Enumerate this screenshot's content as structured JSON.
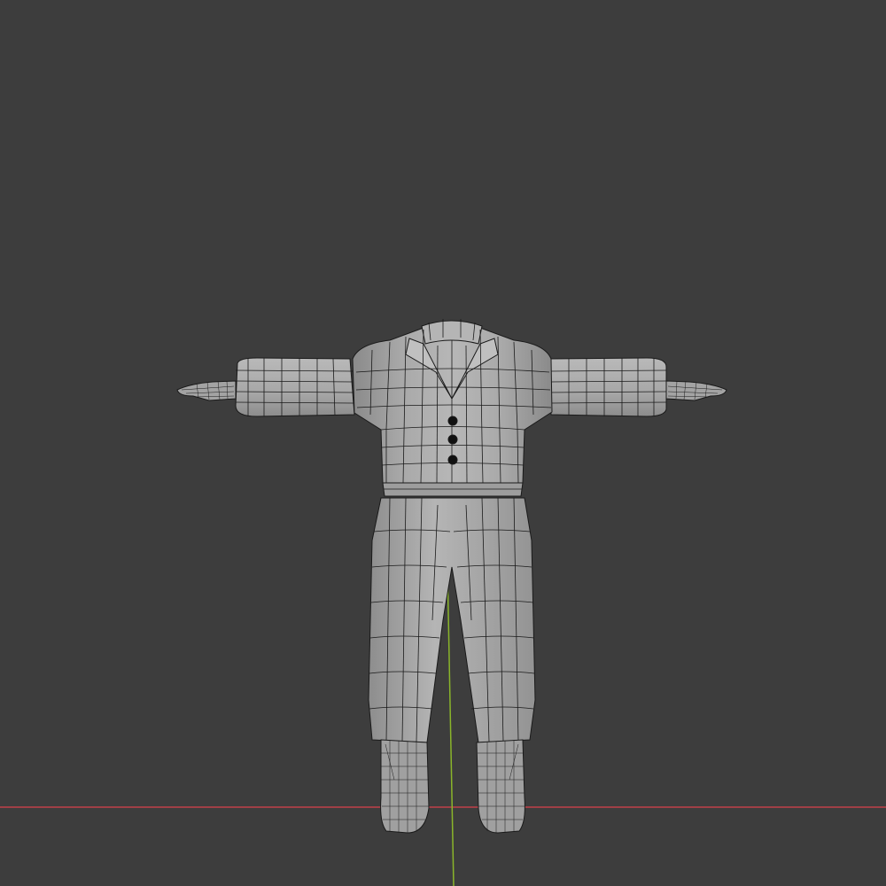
{
  "viewport": {
    "background": "#3d3d3d",
    "mode": "wireframe-overlay",
    "view": "front-orthographic"
  },
  "scene": {
    "object": "character-suit-mesh",
    "pose": "T-pose",
    "parts": [
      "jacket",
      "trousers",
      "boots",
      "hands",
      "buttons"
    ],
    "button_count": 3
  },
  "axes": {
    "x_axis_color": "#c0404a",
    "y_axis_color": "#8ab52a"
  },
  "colors": {
    "mesh_fill": "#aeaeae",
    "mesh_shade": "#8f8f8f",
    "wire": "#1a1a1a",
    "button": "#111111"
  }
}
